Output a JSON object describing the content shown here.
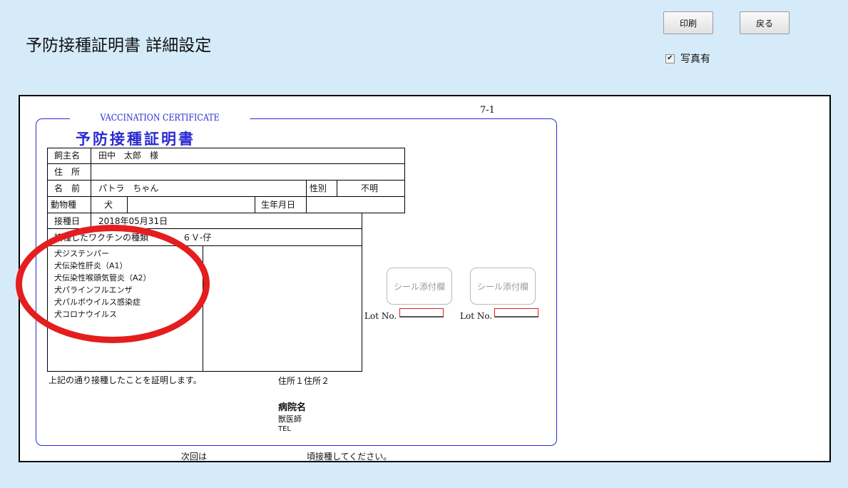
{
  "page": {
    "title": "予防接種証明書 詳細設定",
    "print_label": "印刷",
    "back_label": "戻る",
    "photo_option_label": "写真有",
    "photo_option_checked": true
  },
  "certificate": {
    "page_number": "7-1",
    "title_en": "VACCINATION CERTIFICATE",
    "title_jp": "予防接種証明書",
    "owner": {
      "label": "飼主名",
      "value": "田中　太郎　様"
    },
    "address": {
      "label": "住　所",
      "value": ""
    },
    "name": {
      "label": "名　前",
      "value": "パトラ　ちゃん"
    },
    "sex": {
      "label": "性別",
      "value": "不明"
    },
    "species": {
      "label": "動物種",
      "value": "犬"
    },
    "birth": {
      "label": "生年月日",
      "value": ""
    },
    "vaccination_date": {
      "label": "接種日",
      "value": "2018年05月31日"
    },
    "vaccine_type": {
      "label": "接種したワクチンの種類",
      "value": "６Ｖ-仔"
    },
    "vaccine_items": [
      "犬ジステンパー",
      "犬伝染性肝炎（A1）",
      "犬伝染性喉頭気管炎（A2）",
      "犬パラインフルエンザ",
      "犬パルボウイルス感染症",
      "犬コロナウイルス"
    ],
    "seal_label": "シール添付欄",
    "lot_label": "Lot No.",
    "certify_text": "上記の通り接種したことを証明します。",
    "clinic_address": "住所１住所２",
    "clinic_name": "病院名",
    "vet_label": "獣医師",
    "tel_label": "TEL",
    "next_prefix": "次回は",
    "next_suffix": "頃接種してください。"
  },
  "colors": {
    "background": "#d6ebfa",
    "accent_blue": "#2a2ad2",
    "highlight_red": "#e41e1e"
  }
}
